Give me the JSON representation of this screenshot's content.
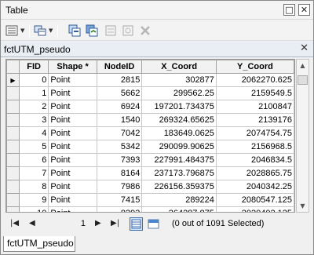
{
  "window": {
    "title": "Table"
  },
  "tab": {
    "name": "fctUTM_pseudo"
  },
  "bottom_tab": {
    "name": "fctUTM_pseudo"
  },
  "columns": [
    "FID",
    "Shape *",
    "NodeID",
    "X_Coord",
    "Y_Coord"
  ],
  "rows": [
    [
      "0",
      "Point",
      "2815",
      "302877",
      "2062270.625"
    ],
    [
      "1",
      "Point",
      "5662",
      "299562.25",
      "2159549.5"
    ],
    [
      "2",
      "Point",
      "6924",
      "197201.734375",
      "2100847"
    ],
    [
      "3",
      "Point",
      "1540",
      "269324.65625",
      "2139176"
    ],
    [
      "4",
      "Point",
      "7042",
      "183649.0625",
      "2074754.75"
    ],
    [
      "5",
      "Point",
      "5342",
      "290099.90625",
      "2156968.5"
    ],
    [
      "6",
      "Point",
      "7393",
      "227991.484375",
      "2046834.5"
    ],
    [
      "7",
      "Point",
      "8164",
      "237173.796875",
      "2028865.75"
    ],
    [
      "8",
      "Point",
      "7986",
      "226156.359375",
      "2040342.25"
    ],
    [
      "9",
      "Point",
      "7415",
      "289224",
      "2080547.125"
    ],
    [
      "10",
      "Point",
      "8293",
      "264287.875",
      "2020402.125"
    ]
  ],
  "navigation": {
    "current_record": "1",
    "status": "(0 out of 1091 Selected)"
  },
  "icons": {
    "row_pointer": "row-pointer-icon"
  }
}
